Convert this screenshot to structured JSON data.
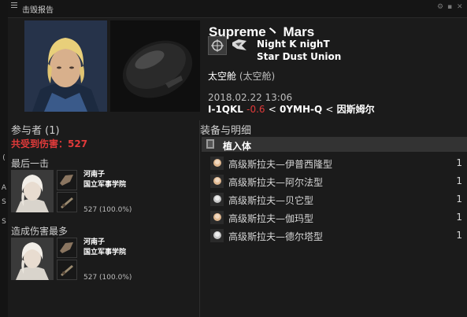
{
  "window": {
    "title": "击毁报告"
  },
  "left_strip": {
    "labels": [
      "(",
      "A",
      "S",
      "S"
    ]
  },
  "victim": {
    "name": "Supreme丶 Mars",
    "corporation": "Night K nighT",
    "alliance": "Star Dust Union",
    "ship_type": "太空舱",
    "ship_class": "(太空舱)",
    "timestamp": "2018.02.22 13:06",
    "system": "I-1QKL",
    "security": "-0.6",
    "lt1": "<",
    "constellation": "0YMH-Q",
    "lt2": "<",
    "region": "因斯姆尔"
  },
  "participants": {
    "header": "参与者 (1)",
    "total_damage": "共受到伤害：527",
    "final_blow_label": "最后一击",
    "top_damage_label": "造成伤害最多",
    "final_blow": {
      "name": "河南子",
      "corp": "国立军事学院",
      "damage": "527 (100.0%)"
    },
    "top_damage": {
      "name": "河南子",
      "corp": "国立军事学院",
      "damage": "527 (100.0%)"
    }
  },
  "fittings": {
    "header": "装备与明细",
    "section": "植入体",
    "items": [
      {
        "name": "高级斯拉夫—伊普西隆型",
        "qty": "1"
      },
      {
        "name": "高级斯拉夫—阿尔法型",
        "qty": "1"
      },
      {
        "name": "高级斯拉夫—贝它型",
        "qty": "1"
      },
      {
        "name": "高级斯拉夫—伽玛型",
        "qty": "1"
      },
      {
        "name": "高级斯拉夫—德尔塔型",
        "qty": "1"
      }
    ]
  },
  "colors": {
    "accent_red": "#e03a3a",
    "background": "#1b1b1b"
  }
}
